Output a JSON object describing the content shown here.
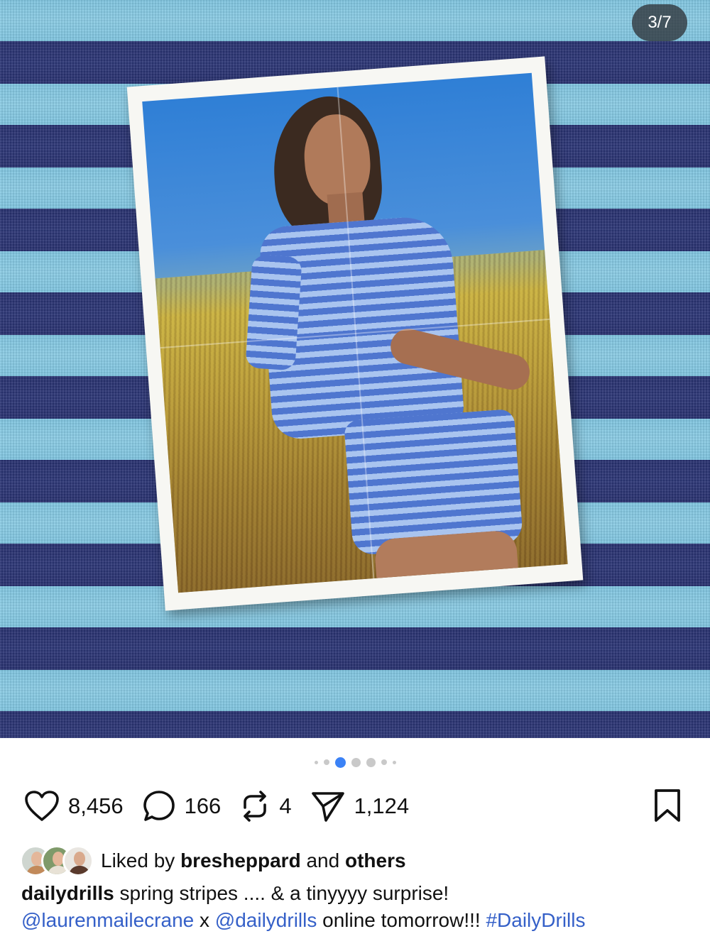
{
  "media": {
    "counter": "3/7",
    "colors": {
      "light_stripe": "#8acbe4",
      "dark_stripe": "#2c3676"
    }
  },
  "carousel": {
    "total_dots": 7,
    "active_index": 2
  },
  "actions": {
    "like_count": "8,456",
    "comment_count": "166",
    "repost_count": "4",
    "share_count": "1,124"
  },
  "likes": {
    "prefix": "Liked by",
    "user": "bresheppard",
    "middle": "and",
    "others": "others"
  },
  "caption": {
    "username": "dailydrills",
    "text": "spring stripes .... & a tinyyyy surprise!",
    "mention1": "@laurenmailecrane",
    "joiner": "x",
    "mention2": "@dailydrills",
    "text2": "online tomorrow!!!",
    "hashtag": "#DailyDrills"
  },
  "icons": [
    "heart-icon",
    "comment-icon",
    "repost-icon",
    "share-icon",
    "bookmark-icon"
  ],
  "accent_color": "#3b82f6"
}
